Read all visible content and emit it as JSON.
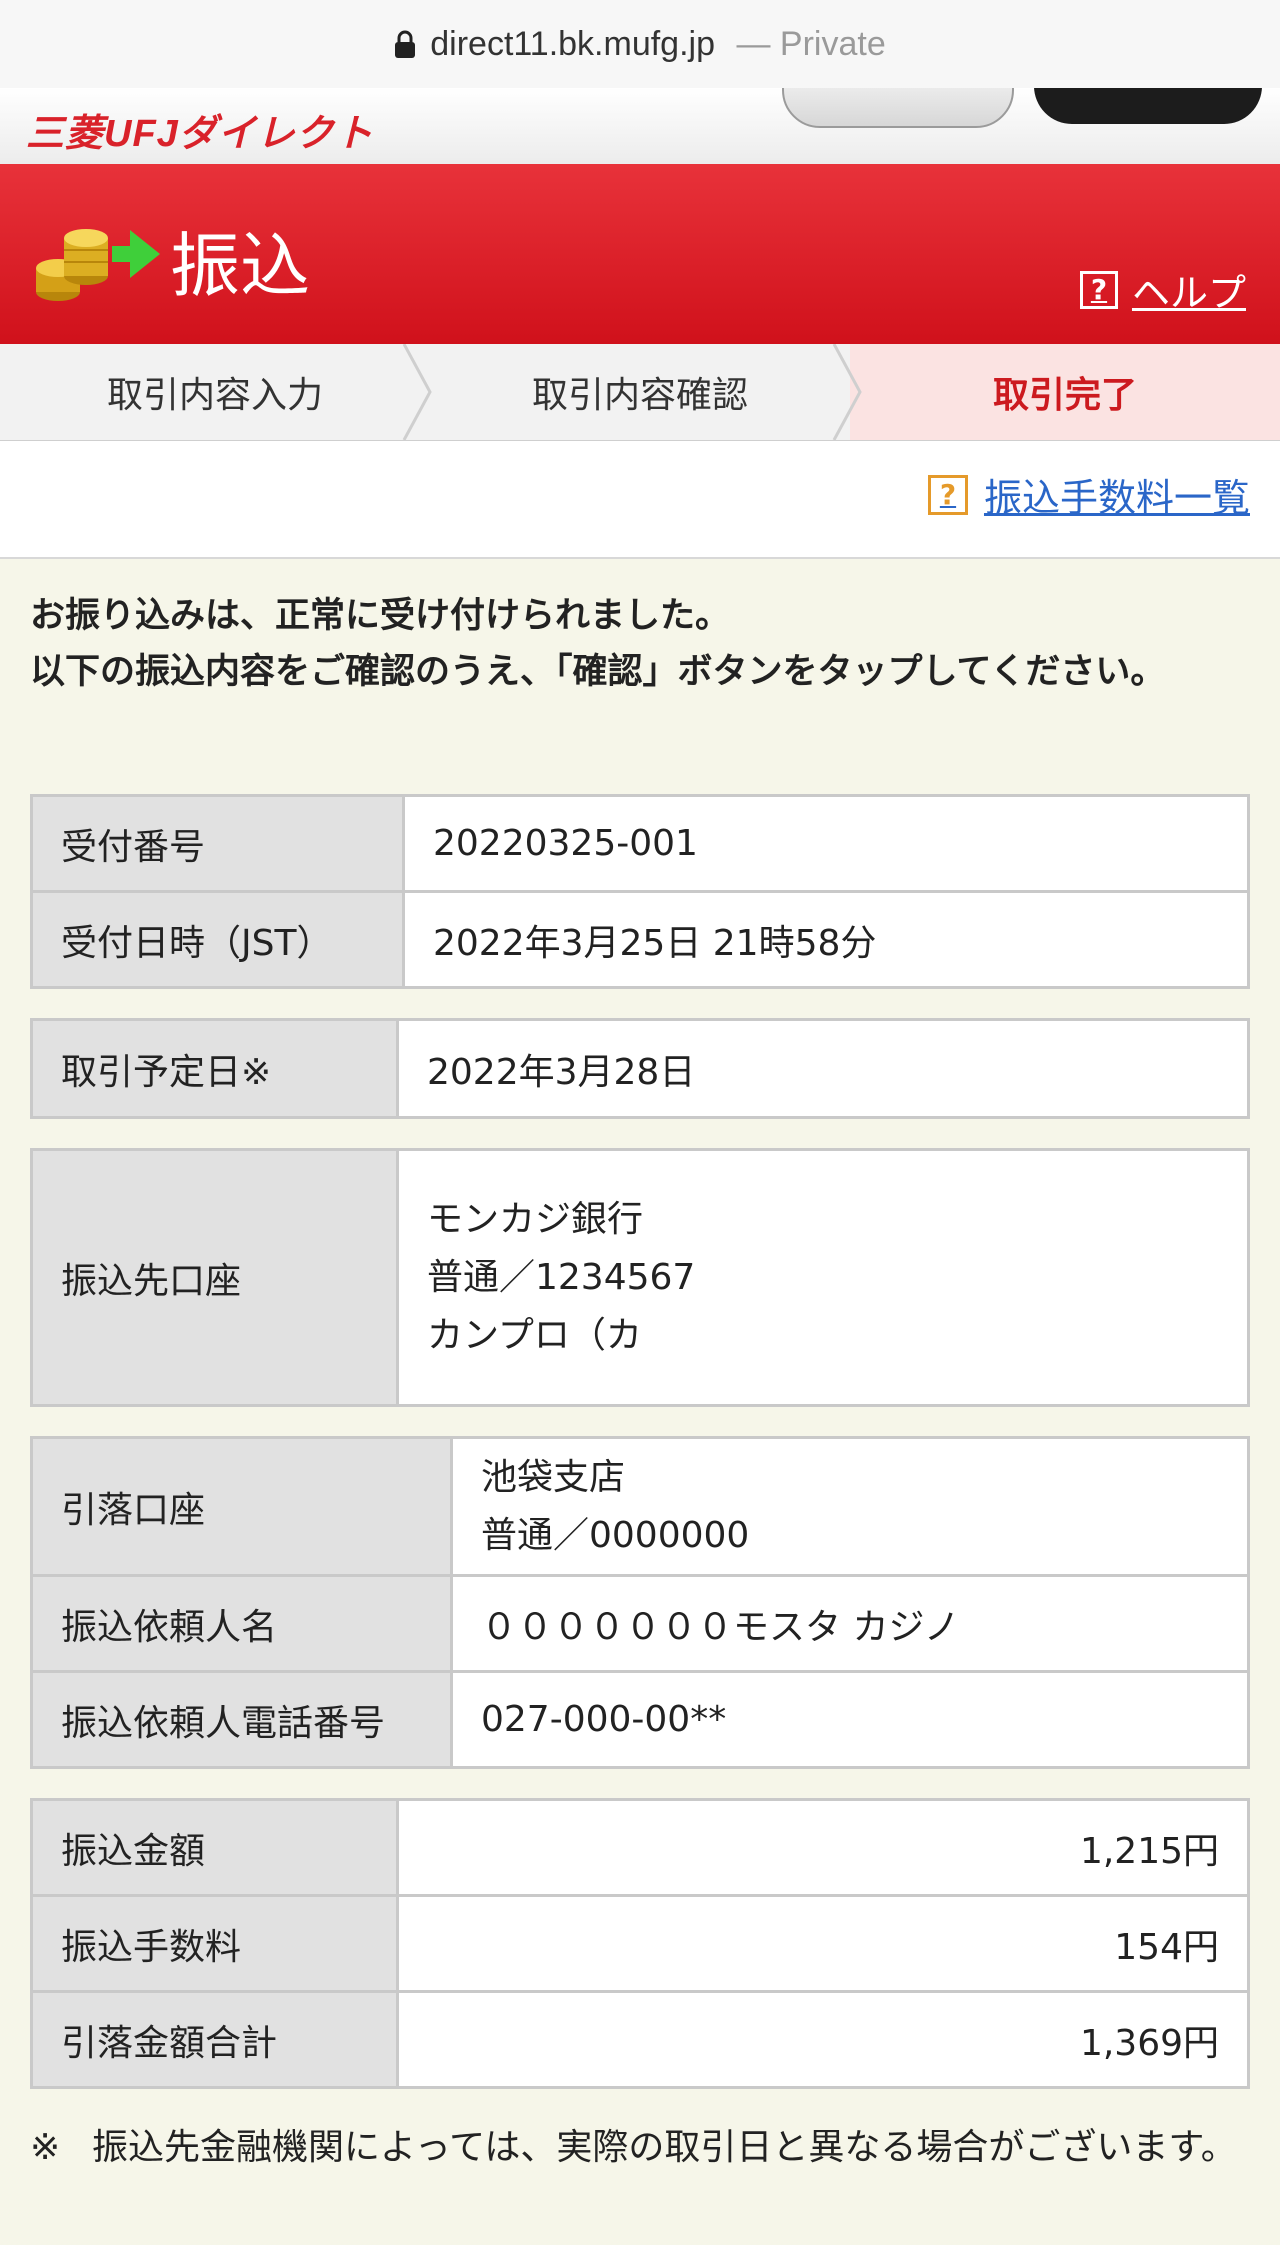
{
  "browser": {
    "url": "direct11.bk.mufg.jp",
    "separator": "—",
    "mode": "Private"
  },
  "header": {
    "logo_text": "三菱UFJダイレクト"
  },
  "banner": {
    "title": "振込",
    "help_label": "ヘルプ",
    "help_icon": "?"
  },
  "steps": [
    {
      "label": "取引内容入力"
    },
    {
      "label": "取引内容確認"
    },
    {
      "label": "取引完了",
      "active": true
    }
  ],
  "fee_link": {
    "icon": "?",
    "label": "振込手数料一覧"
  },
  "message": {
    "line1": "お振り込みは、正常に受け付けられました。",
    "line2": "以下の振込内容をご確認のうえ、「確認」ボタンをタップしてください。"
  },
  "receipt": {
    "number_label": "受付番号",
    "number_value": "20220325-001",
    "datetime_label": "受付日時（JST）",
    "datetime_value": "2022年3月25日 21時58分"
  },
  "schedule": {
    "label": "取引予定日※",
    "value": "2022年3月28日"
  },
  "destination": {
    "label": "振込先口座",
    "bank": "モンカジ銀行",
    "account": "普通／1234567",
    "holder": "カンプロ（カ"
  },
  "source": {
    "account_label": "引落口座",
    "branch": "池袋支店",
    "account": "普通／0000000",
    "requester_label": "振込依頼人名",
    "requester_value": "０００００００モスタ カジノ",
    "phone_label": "振込依頼人電話番号",
    "phone_value": "027-000-00**"
  },
  "amounts": {
    "transfer_label": "振込金額",
    "transfer_value": "1,215円",
    "fee_label": "振込手数料",
    "fee_value": "154円",
    "total_label": "引落金額合計",
    "total_value": "1,369円"
  },
  "note": {
    "mark": "※",
    "text": "振込先金融機関によっては、実際の取引日と異なる場合がございます。"
  },
  "colors": {
    "brand_red": "#d9222a",
    "link_blue": "#2a66c8",
    "help_orange": "#e59a2a",
    "page_bg": "#f6f6e9"
  }
}
